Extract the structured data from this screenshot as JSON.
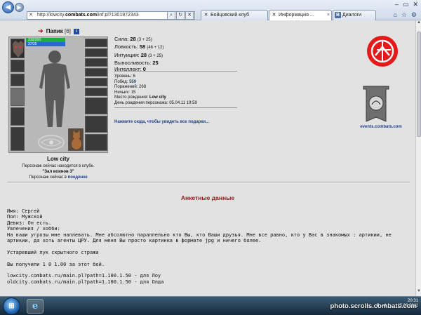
{
  "browser": {
    "url_prefix": "http://lowcity.",
    "url_domain": "combats.com",
    "url_path": "/inf.pl?1301972343",
    "tabs": [
      {
        "label": "Бойцовский клуб",
        "active": false
      },
      {
        "label": "Информация ...",
        "active": true
      },
      {
        "label": "Диалоги",
        "active": false
      }
    ]
  },
  "character": {
    "name": "Папик",
    "level": "[6]",
    "flag": "i",
    "hp": "310/310",
    "mp": "37/25",
    "city": "Low city",
    "location_text": "Персонаж сейчас находится в клубе.",
    "club": "\"Зал воинов 3\"",
    "now_text": "Персонаж сейчас в",
    "duel_link": "поединке"
  },
  "stats": [
    {
      "label": "Сила:",
      "value": "28",
      "extra": "(3 + 25)"
    },
    {
      "label": "Ловкость:",
      "value": "58",
      "extra": "(46 + 12)"
    },
    {
      "label": "Интуиция:",
      "value": "28",
      "extra": "(3 + 25)"
    },
    {
      "label": "Выносливость:",
      "value": "25",
      "extra": ""
    },
    {
      "label": "Интеллект:",
      "value": "0",
      "extra": ""
    }
  ],
  "details": {
    "level": "Уровень: 6",
    "wins_label": "Побед:",
    "wins_value": "559",
    "losses": "Поражений: 268",
    "draws": "Ничьих: 15",
    "birth_place_label": "Место рождения:",
    "birth_place_value": "Low city",
    "birthday": "День рождения персонажа: 05.04.11 19:59"
  },
  "gifts_link": "Нажмите сюда, чтобы увидеть все подарки...",
  "events_link": "events.combats.com",
  "profile": {
    "title": "Анкетные данные",
    "name": "Имя: Сергей",
    "gender": "Пол: Мужской",
    "motto": "Девиз: Он есть.",
    "hobby_label": "Увлечения / хобби:",
    "about": "На ваши угрозы мне наплевать. Мне абсолютно параллельно кто Вы, кто Ваши друзья. Мне все равно, кто у Вас в знакомых : артикии, не артикии, да хоть агенты ЦРУ. Для меня Вы просто картинка в формате jpg и ничего более.",
    "bow_line": "Устаревший лук скрытного стража",
    "received_line": "Вы получили 1 0 1.00 за этот бой.",
    "link_1": "lowcity.combats.ru/main.pl?path=1.100.1.50 - для Лоу",
    "link_2": "oldcity.combats.ru/main.pl?path=1.100.1.50 - для Олда"
  },
  "taskbar": {
    "time": "20:31",
    "date": "15.06.2011"
  },
  "watermark": "photo.scrolls.combats.com"
}
